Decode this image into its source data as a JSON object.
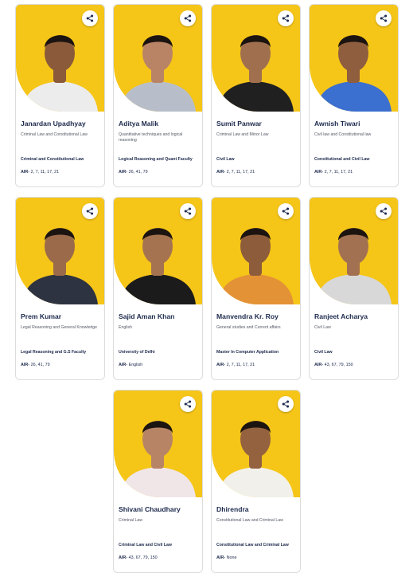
{
  "colors": {
    "card_accent": "#f5c518",
    "name_text": "#1d2a4d",
    "meta_text": "#555a66",
    "card_border": "#dcdcdc"
  },
  "share_icon": "share-icon",
  "air_label": "AIR-",
  "faculty": [
    {
      "name": "Janardan Upadhyay",
      "subjects": "Criminal Law and Constitutional Law",
      "specialization": "Criminal and Constitutional Law",
      "air": "2, 7, 11, 17, 21",
      "shirt": "#ececec",
      "skin": "#8a5a3a"
    },
    {
      "name": "Aditya Malik",
      "subjects": "Quantitative techniques and logical reasoning",
      "specialization": "Logical Reasoning and Quant Faculty",
      "air": "26, 41, 79",
      "shirt": "#b8bec9",
      "skin": "#b98466"
    },
    {
      "name": "Sumit Panwar",
      "subjects": "Criminal Law and Minor Law",
      "specialization": "Civil Law",
      "air": "2, 7, 11, 17, 21",
      "shirt": "#202020",
      "skin": "#a0704e"
    },
    {
      "name": "Awnish Tiwari",
      "subjects": "Civil law and Constitutional law",
      "specialization": "Constitutional and Civil Law",
      "air": "2, 7, 11, 17, 21",
      "shirt": "#3b6fd0",
      "skin": "#8f5e3f"
    },
    {
      "name": "Prem Kumar",
      "subjects": "Legal Reasoning and General Knowledge",
      "specialization": "Legal Reasoning and G.S Faculty",
      "air": "26, 41, 79",
      "shirt": "#2d3340",
      "skin": "#9a6a4a"
    },
    {
      "name": "Sajid Aman Khan",
      "subjects": "English",
      "specialization": "University of Delhi",
      "air": "English",
      "shirt": "#1b1b1b",
      "skin": "#a57350"
    },
    {
      "name": "Manvendra Kr. Roy",
      "subjects": "General studies and Current affairs",
      "specialization": "Master In Computer Application",
      "air": "2, 7, 11, 17, 21",
      "shirt": "#e39236",
      "skin": "#8d5c3b"
    },
    {
      "name": "Ranjeet Acharya",
      "subjects": "Civil Law",
      "specialization": "Civil Law",
      "air": "43, 67, 79, 150",
      "shirt": "#d8d8d8",
      "skin": "#a27152"
    },
    {
      "name": "Shivani Chaudhary",
      "subjects": "Criminal Law",
      "specialization": "Criminal Law and Civil Law",
      "air": "43, 67, 79, 150",
      "shirt": "#f0e6e8",
      "skin": "#b88466"
    },
    {
      "name": "Dhirendra",
      "subjects": "Constitutional Law and Criminal Law",
      "specialization": "Constitutional Law and Criminal Law",
      "air": "None",
      "shirt": "#f2f0ea",
      "skin": "#94623f"
    }
  ]
}
